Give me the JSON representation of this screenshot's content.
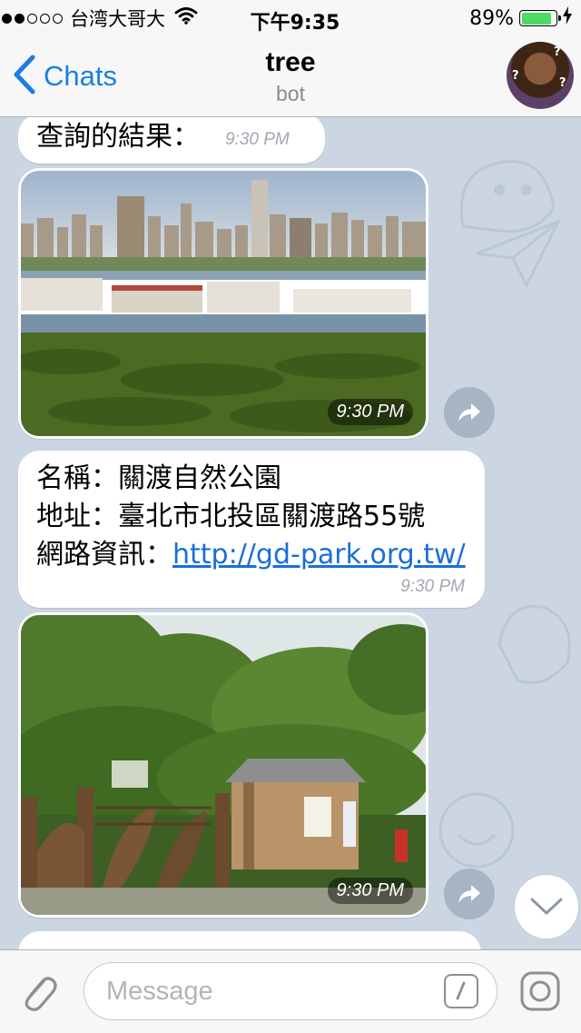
{
  "status_bar": {
    "signal_dots": [
      true,
      true,
      false,
      false,
      false
    ],
    "carrier": "台湾大哥大",
    "time": "下午9:35",
    "battery_percent": "89%",
    "battery_level": 0.89,
    "icons": [
      "wifi-icon",
      "battery-icon",
      "charging-icon"
    ]
  },
  "nav": {
    "back_label": "Chats",
    "title": "tree",
    "subtitle": "bot"
  },
  "messages": [
    {
      "type": "text",
      "lines": [
        "查詢的結果："
      ],
      "time": "9:30 PM"
    },
    {
      "type": "photo",
      "subject": "city skyline across river with mangroves",
      "time": "9:30 PM"
    },
    {
      "type": "text",
      "lines": [
        "名稱：關渡自然公園",
        "地址：臺北市北投區關渡路55號"
      ],
      "link_prefix": "網路資訊：",
      "link": "http://gd-park.org.tw/",
      "time": "9:30 PM"
    },
    {
      "type": "photo",
      "subject": "park entrance with trees",
      "time": "9:30 PM"
    }
  ],
  "input": {
    "placeholder": "Message",
    "icons": [
      "attach-icon",
      "command-icon",
      "camera-icon"
    ]
  },
  "colors": {
    "accent": "#1a7fe0",
    "link": "#1a6ed8",
    "chat_background": "#ccd6e2",
    "battery": "#4cd964"
  }
}
